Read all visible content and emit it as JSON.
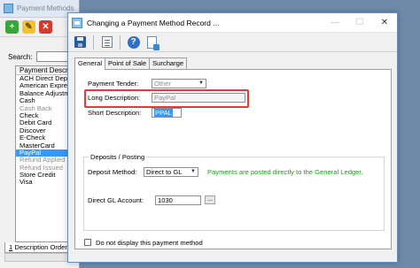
{
  "background_window": {
    "title": "Payment Methods",
    "search_label": "Search:",
    "list_header": "Payment Descrip",
    "items": [
      {
        "label": "ACH Direct Depo",
        "state": "normal"
      },
      {
        "label": "American Express",
        "state": "normal"
      },
      {
        "label": "Balance Adjustme",
        "state": "normal"
      },
      {
        "label": "Cash",
        "state": "normal"
      },
      {
        "label": "Cash Back",
        "state": "dim"
      },
      {
        "label": "Check",
        "state": "normal"
      },
      {
        "label": "Debit Card",
        "state": "normal"
      },
      {
        "label": "Discover",
        "state": "normal"
      },
      {
        "label": "E-Check",
        "state": "normal"
      },
      {
        "label": "MasterCard",
        "state": "normal"
      },
      {
        "label": "PayPal",
        "state": "selected"
      },
      {
        "label": "Refund Applied",
        "state": "dim"
      },
      {
        "label": "Refund Issued",
        "state": "dim"
      },
      {
        "label": "Store Credit",
        "state": "normal"
      },
      {
        "label": "Visa",
        "state": "normal"
      }
    ],
    "bottom_tab_number": "1",
    "bottom_tab_label": "Description Order"
  },
  "dialog": {
    "title": "Changing a Payment Method Record ...",
    "controls": {
      "minimize": "—",
      "maximize": "☐",
      "close": "✕"
    },
    "toolbar_icons": [
      "save-icon",
      "properties-icon",
      "help-icon",
      "document-icon"
    ],
    "tabs": [
      "General",
      "Point of Sale",
      "Surcharge"
    ],
    "active_tab": "General",
    "fields": {
      "payment_tender_label": "Payment Tender:",
      "payment_tender_value": "Other",
      "long_description_label": "Long Description:",
      "long_description_value": "PayPal",
      "short_description_label": "Short Description:",
      "short_description_value": "PPAL"
    },
    "deposits_group": {
      "title": "Deposits / Posting",
      "deposit_method_label": "Deposit Method:",
      "deposit_method_value": "Direct to GL",
      "note": "Payments are posted directly to the General Ledger.",
      "direct_gl_label": "Direct GL Account:",
      "direct_gl_value": "1030",
      "browse_label": "..."
    },
    "checkbox_label": "Do not display this payment method"
  },
  "colors": {
    "selection": "#3399ff",
    "highlight_box": "#e03c3c",
    "note_green": "#1e9a1e"
  }
}
